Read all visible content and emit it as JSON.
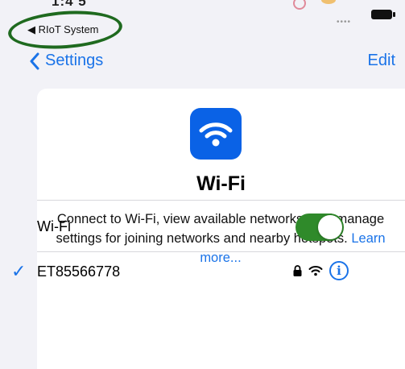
{
  "status_bar": {
    "back_app": "◀ RIoT System",
    "time_fragment": "1:4 5"
  },
  "nav": {
    "back_label": "Settings",
    "edit_label": "Edit"
  },
  "wifi_card": {
    "icon": "wifi-icon",
    "title": "Wi-Fi",
    "description": "Connect to Wi-Fi, view available networks, and manage settings for joining networks and nearby hotspots.",
    "learn_more": "Learn more..."
  },
  "wifi_toggle": {
    "label": "Wi-Fi",
    "enabled": true
  },
  "connected_network": {
    "name": "ET85566778",
    "secured": true,
    "icons": [
      "check-icon",
      "lock-icon",
      "wifi-icon",
      "info-icon"
    ]
  },
  "colors": {
    "accent": "#1a73e8",
    "toggle_on": "#2f8a2a",
    "wifi_icon_bg": "#0a62e6",
    "highlight": "#1f6a1f"
  }
}
